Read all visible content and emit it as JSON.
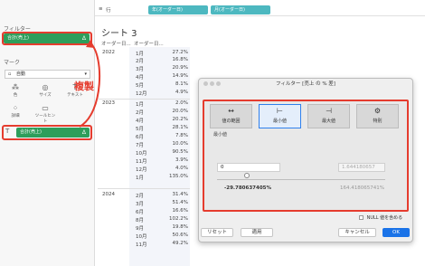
{
  "left": {
    "filters_title": "フィルター",
    "filter_pill": "合計(売上)",
    "marks_title": "マーク",
    "marks_type": "自動",
    "mark_buttons": [
      "色",
      "サイズ",
      "テキスト",
      "詳細",
      "ツールヒント"
    ],
    "copied_pill": "合計(売上)"
  },
  "annotation": "複製",
  "shelf": {
    "icon_label": "行",
    "pills": [
      "年(オーダー日)",
      "月(オーダー日)"
    ]
  },
  "sheet_title": "シート 3",
  "table": {
    "headers": [
      "オーダー日...",
      "オーダー日..."
    ],
    "years": [
      "2022",
      "2023",
      "2024"
    ],
    "rows": [
      {
        "month": "1月",
        "value": "27.2%"
      },
      {
        "month": "2月",
        "value": "16.8%"
      },
      {
        "month": "3月",
        "value": "20.9%"
      },
      {
        "month": "4月",
        "value": "14.9%"
      },
      {
        "month": "5月",
        "value": "8.1%"
      },
      {
        "month": "12月",
        "value": "4.9%"
      },
      {
        "month": "1月",
        "value": "2.0%"
      },
      {
        "month": "2月",
        "value": "20.0%"
      },
      {
        "month": "4月",
        "value": "20.2%"
      },
      {
        "month": "5月",
        "value": "28.1%"
      },
      {
        "month": "6月",
        "value": "7.8%"
      },
      {
        "month": "7月",
        "value": "10.0%"
      },
      {
        "month": "10月",
        "value": "90.5%"
      },
      {
        "month": "11月",
        "value": "3.9%"
      },
      {
        "month": "12月",
        "value": "4.0%"
      },
      {
        "month": "1月",
        "value": "135.0%"
      },
      {
        "month": "2月",
        "value": "31.4%"
      },
      {
        "month": "3月",
        "value": "51.4%"
      },
      {
        "month": "6月",
        "value": "16.6%"
      },
      {
        "month": "8月",
        "value": "102.2%"
      },
      {
        "month": "9月",
        "value": "19.8%"
      },
      {
        "month": "10月",
        "value": "50.6%"
      },
      {
        "month": "11月",
        "value": "49.2%"
      }
    ]
  },
  "dialog": {
    "title": "フィルター [売上 の % 差]",
    "tabs": [
      "値の範囲",
      "最小値",
      "最大値",
      "特別"
    ],
    "selected_tab": "最小値",
    "min_label": "最小値",
    "min_input": "0",
    "max_input_placeholder": "1.644180657",
    "range_min": "-29.780637405%",
    "range_max": "164.418065741%",
    "null_label": "NULL 値を含める",
    "buttons": {
      "reset": "リセット",
      "apply": "適用",
      "cancel": "キャンセル",
      "ok": "OK"
    }
  },
  "colors": {
    "accent_green": "#2e9e5b",
    "highlight_red": "#e53c2e",
    "teal_pill": "#4db8c0",
    "primary_blue": "#1a73e8"
  }
}
